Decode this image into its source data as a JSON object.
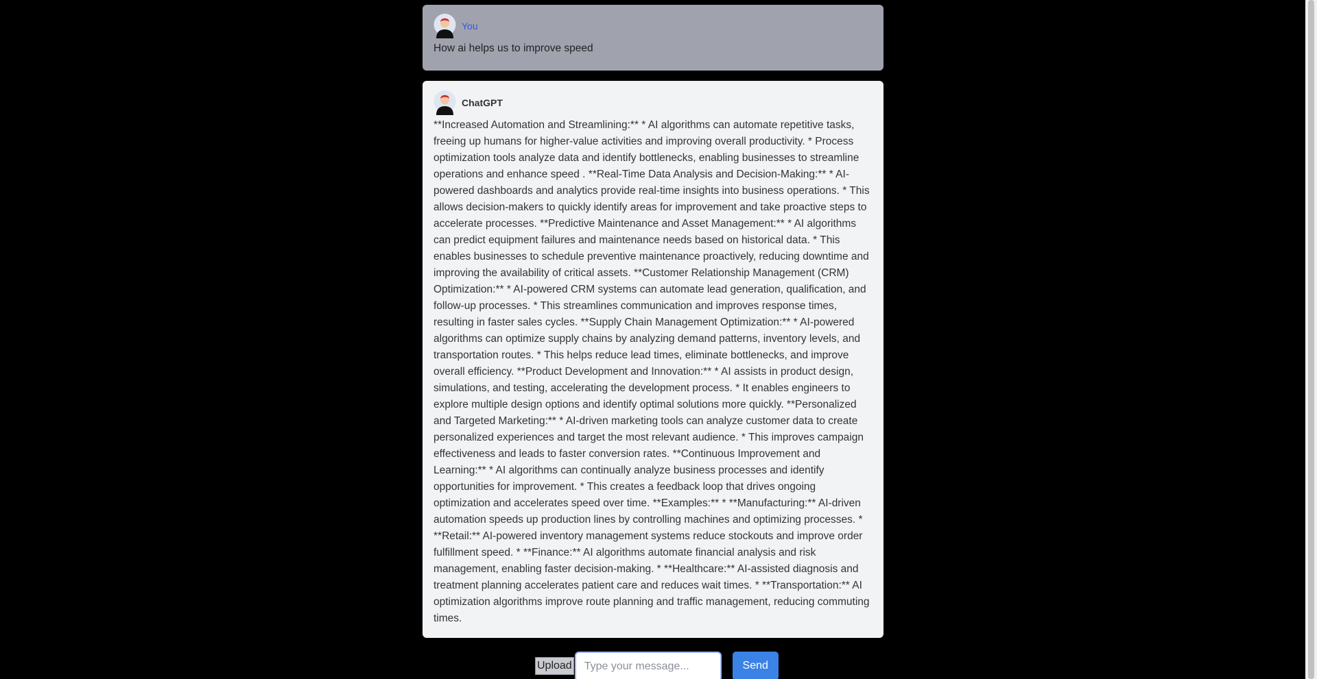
{
  "messages": {
    "user": {
      "author": "You",
      "text": "How ai helps us to improve speed"
    },
    "bot": {
      "author": "ChatGPT",
      "text": "**Increased Automation and Streamlining:** * AI algorithms can automate repetitive tasks, freeing up humans for higher-value activities and improving overall productivity. * Process optimization tools analyze data and identify bottlenecks, enabling businesses to streamline operations and enhance speed . **Real-Time Data Analysis and Decision-Making:** * AI-powered dashboards and analytics provide real-time insights into business operations. * This allows decision-makers to quickly identify areas for improvement and take proactive steps to accelerate processes. **Predictive Maintenance and Asset Management:** * AI algorithms can predict equipment failures and maintenance needs based on historical data. * This enables businesses to schedule preventive maintenance proactively, reducing downtime and improving the availability of critical assets. **Customer Relationship Management (CRM) Optimization:** * AI-powered CRM systems can automate lead generation, qualification, and follow-up processes. * This streamlines communication and improves response times, resulting in faster sales cycles. **Supply Chain Management Optimization:** * AI-powered algorithms can optimize supply chains by analyzing demand patterns, inventory levels, and transportation routes. * This helps reduce lead times, eliminate bottlenecks, and improve overall efficiency. **Product Development and Innovation:** * AI assists in product design, simulations, and testing, accelerating the development process. * It enables engineers to explore multiple design options and identify optimal solutions more quickly. **Personalized and Targeted Marketing:** * AI-driven marketing tools can analyze customer data to create personalized experiences and target the most relevant audience. * This improves campaign effectiveness and leads to faster conversion rates. **Continuous Improvement and Learning:** * AI algorithms can continually analyze business processes and identify opportunities for improvement. * This creates a feedback loop that drives ongoing optimization and accelerates speed over time. **Examples:** * **Manufacturing:** AI-driven automation speeds up production lines by controlling machines and optimizing processes. * **Retail:** AI-powered inventory management systems reduce stockouts and improve order fulfillment speed. * **Finance:** AI algorithms automate financial analysis and risk management, enabling faster decision-making. * **Healthcare:** AI-assisted diagnosis and treatment planning accelerates patient care and reduces wait times. * **Transportation:** AI optimization algorithms improve route planning and traffic management, reducing commuting times."
    }
  },
  "composer": {
    "upload_label": "Upload",
    "input_value": "",
    "input_placeholder": "Type your message...",
    "send_label": "Send"
  },
  "icons": {
    "avatar": "avatar-icon"
  },
  "colors": {
    "background": "#000000",
    "user_bubble": "#a0a3ae",
    "bot_bubble": "#f2f3f5",
    "send_button": "#3b82e6",
    "user_name": "#3b57d6"
  }
}
